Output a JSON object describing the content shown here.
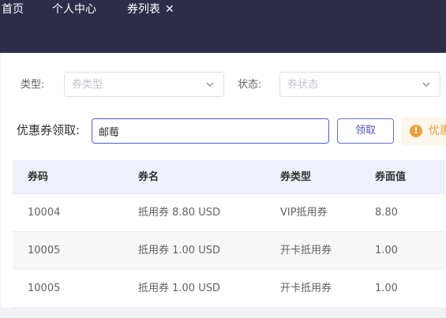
{
  "tabs": [
    {
      "label": "首页"
    },
    {
      "label": "个人中心"
    },
    {
      "label": "券列表",
      "close_glyph": "✕",
      "active": true
    }
  ],
  "filters": {
    "type_label": "类型:",
    "type_placeholder": "券类型",
    "status_label": "状态:",
    "status_placeholder": "券状态"
  },
  "claim": {
    "label": "优惠券领取:",
    "input_value": "邮莓",
    "button_label": "领取"
  },
  "alert": {
    "icon_glyph": "!",
    "text": "优惠",
    "color": "#e6a23c"
  },
  "table": {
    "headers": [
      "券码",
      "券名",
      "券类型",
      "券面值"
    ],
    "rows": [
      [
        "10004",
        "抵用券 8.80 USD",
        "VIP抵用券",
        "8.80"
      ],
      [
        "10005",
        "抵用券 1.00 USD",
        "开卡抵用券",
        "1.00"
      ],
      [
        "10005",
        "抵用券 1.00 USD",
        "开卡抵用券",
        "1.00"
      ]
    ]
  },
  "colors": {
    "topbar": "#2d2d4a",
    "accent": "#4b5fd6",
    "header_bg": "#eef0fb"
  }
}
